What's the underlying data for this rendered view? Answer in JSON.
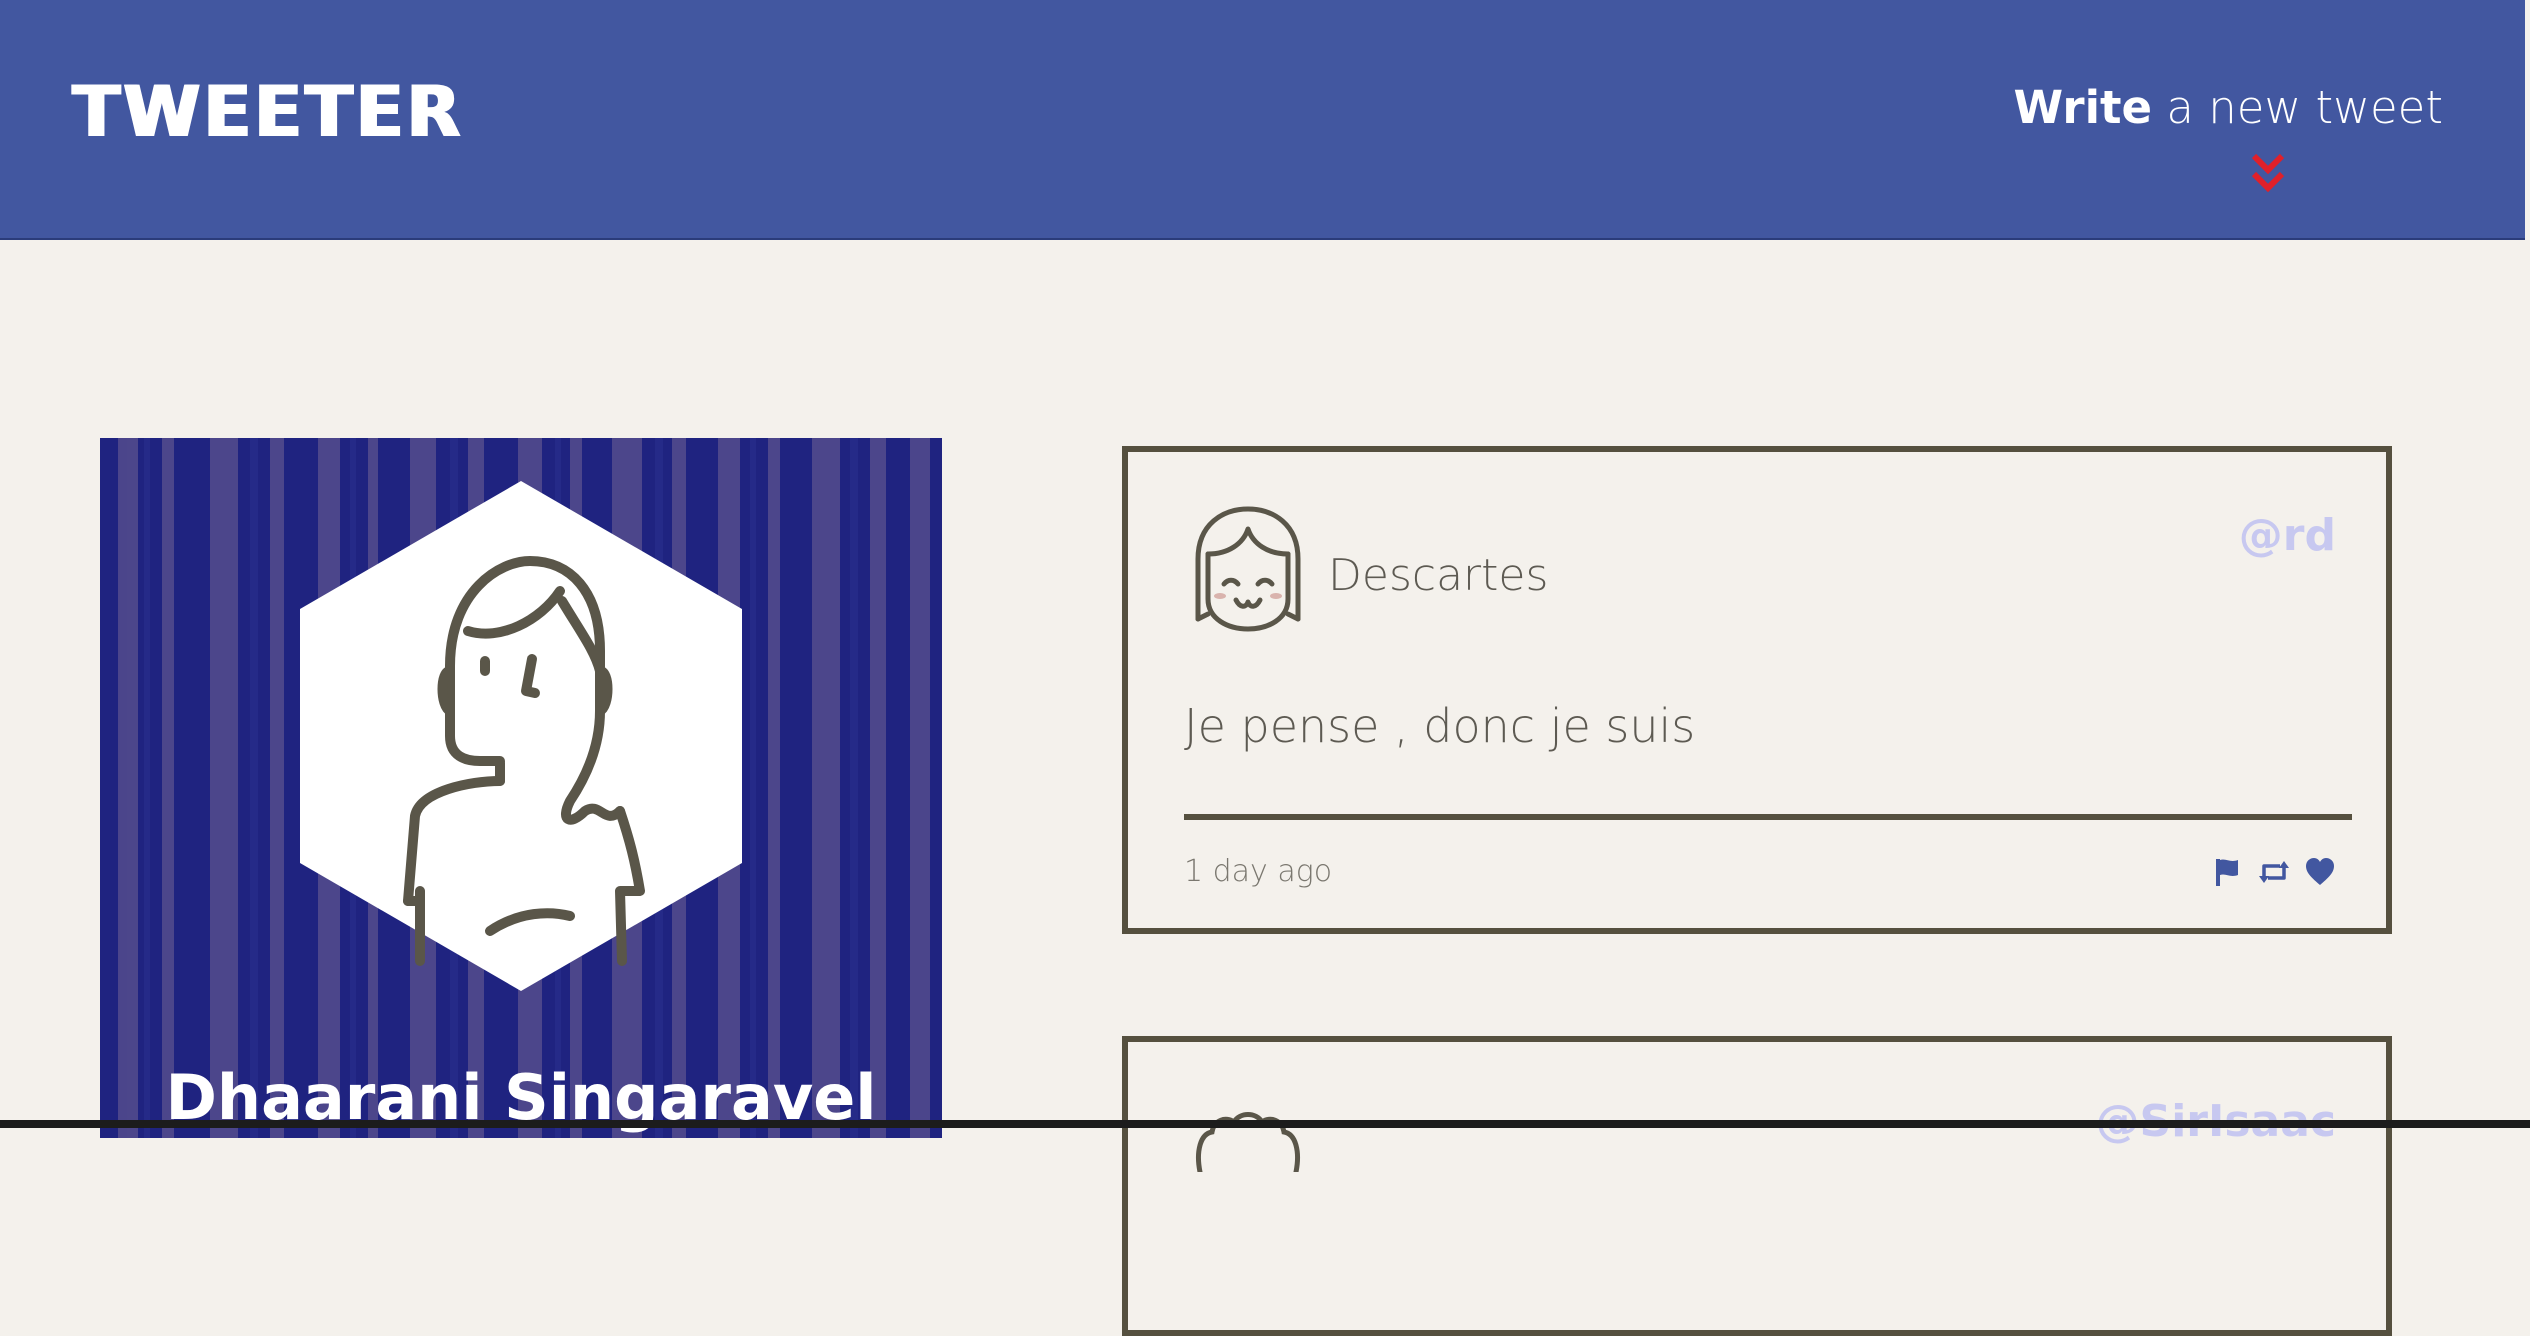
{
  "navbar": {
    "logo": "TWEETER",
    "compose_bold": "Write",
    "compose_rest": " a new tweet",
    "compose_icon": "double-chevron-down-icon",
    "background": "#4257a0",
    "icon_color": "#e0202a"
  },
  "profile": {
    "name": "Dhaarani Singaravel",
    "avatar_icon": "woman-avatar-icon",
    "background": "#1f2380"
  },
  "tweets": [
    {
      "name": "Descartes",
      "handle": "@rd",
      "text": "Je pense , donc je suis",
      "time": "1 day ago",
      "avatar_icon": "girl-avatar-icon",
      "actions": [
        "flag-icon",
        "retweet-icon",
        "heart-icon"
      ]
    },
    {
      "handle": "@SirIsaac",
      "avatar_icon": "curly-hair-avatar-icon"
    }
  ],
  "colors": {
    "page_background": "#f4f1ec",
    "card_border": "#55503f",
    "handle_color": "#c7c8f0",
    "action_color": "#4257a0"
  }
}
